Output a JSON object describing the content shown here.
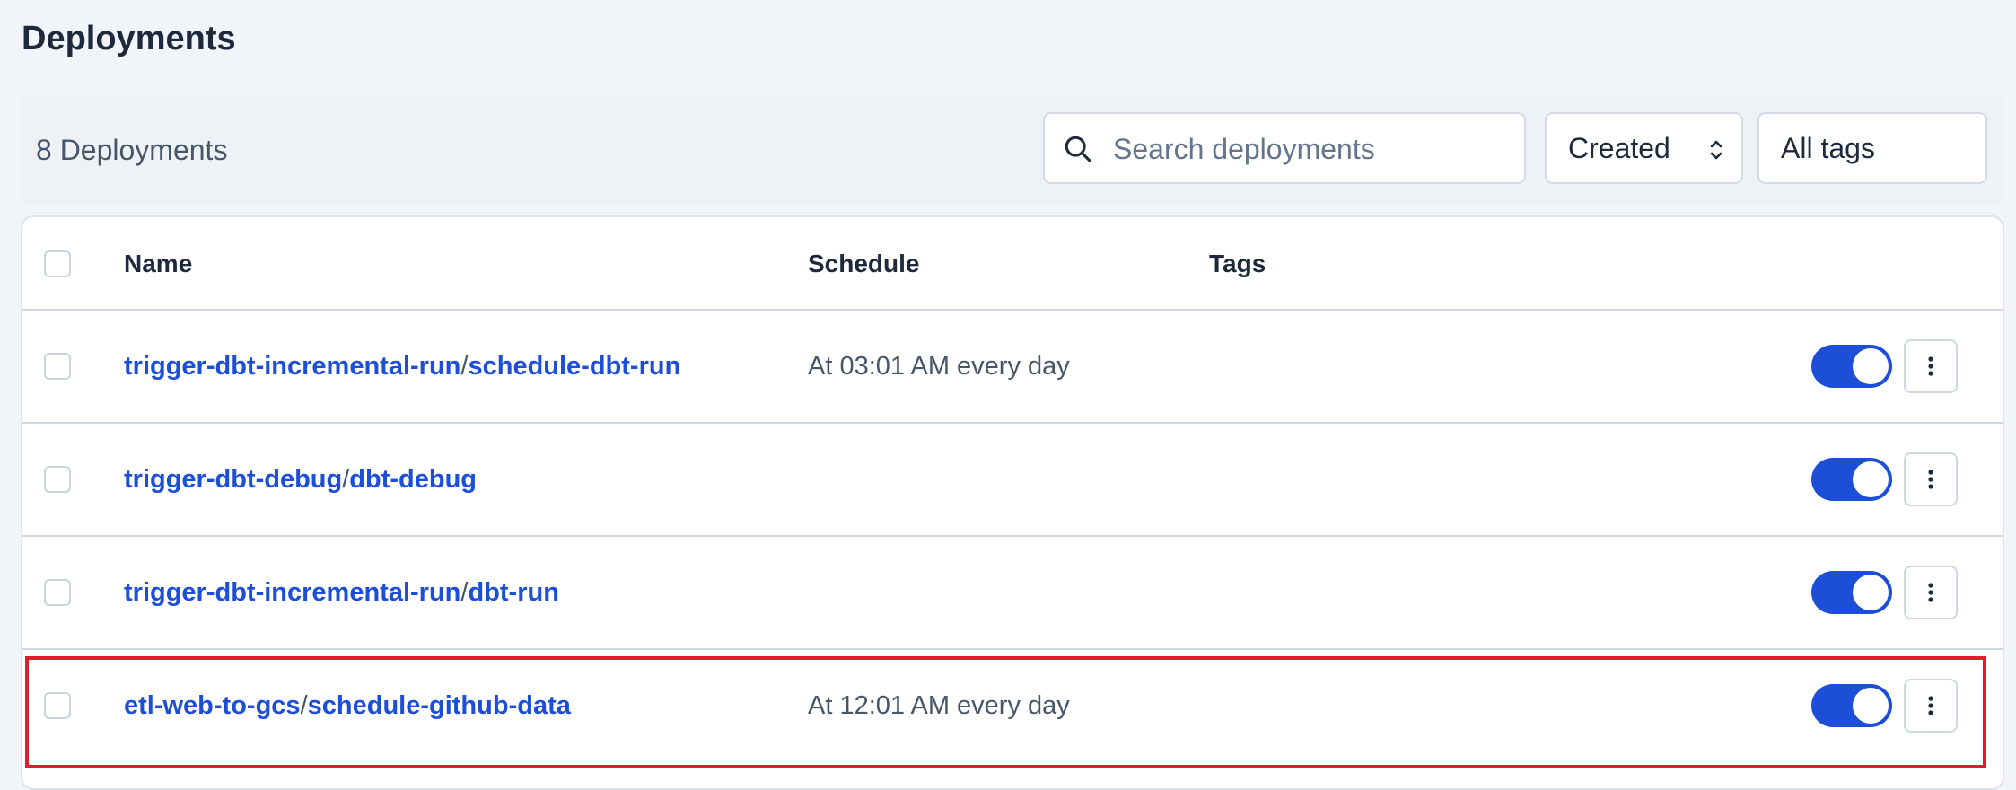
{
  "page": {
    "title": "Deployments"
  },
  "toolbar": {
    "count_label": "8 Deployments",
    "search_placeholder": "Search deployments",
    "search_value": "",
    "sort_selected": "Created",
    "tags_selected": "All tags"
  },
  "table": {
    "columns": {
      "name": "Name",
      "schedule": "Schedule",
      "tags": "Tags"
    },
    "rows": [
      {
        "flow": "trigger-dbt-incremental-run",
        "separator": "/",
        "deployment": "schedule-dbt-run",
        "schedule": "At 03:01 AM every day",
        "enabled": true,
        "highlighted": false
      },
      {
        "flow": "trigger-dbt-debug",
        "separator": "/",
        "deployment": "dbt-debug",
        "schedule": "",
        "enabled": true,
        "highlighted": false
      },
      {
        "flow": "trigger-dbt-incremental-run",
        "separator": "/",
        "deployment": "dbt-run",
        "schedule": "",
        "enabled": true,
        "highlighted": false
      },
      {
        "flow": "etl-web-to-gcs",
        "separator": "/",
        "deployment": "schedule-github-data",
        "schedule": "At 12:01 AM every day",
        "enabled": true,
        "highlighted": true
      }
    ]
  },
  "colors": {
    "accent": "#1d4ed8",
    "highlight_border": "#e11d2a",
    "background": "#f1f5f9"
  },
  "icons": {
    "search": "search-icon",
    "sort": "chevron-up-down-icon",
    "row_menu": "vertical-ellipsis-icon"
  }
}
